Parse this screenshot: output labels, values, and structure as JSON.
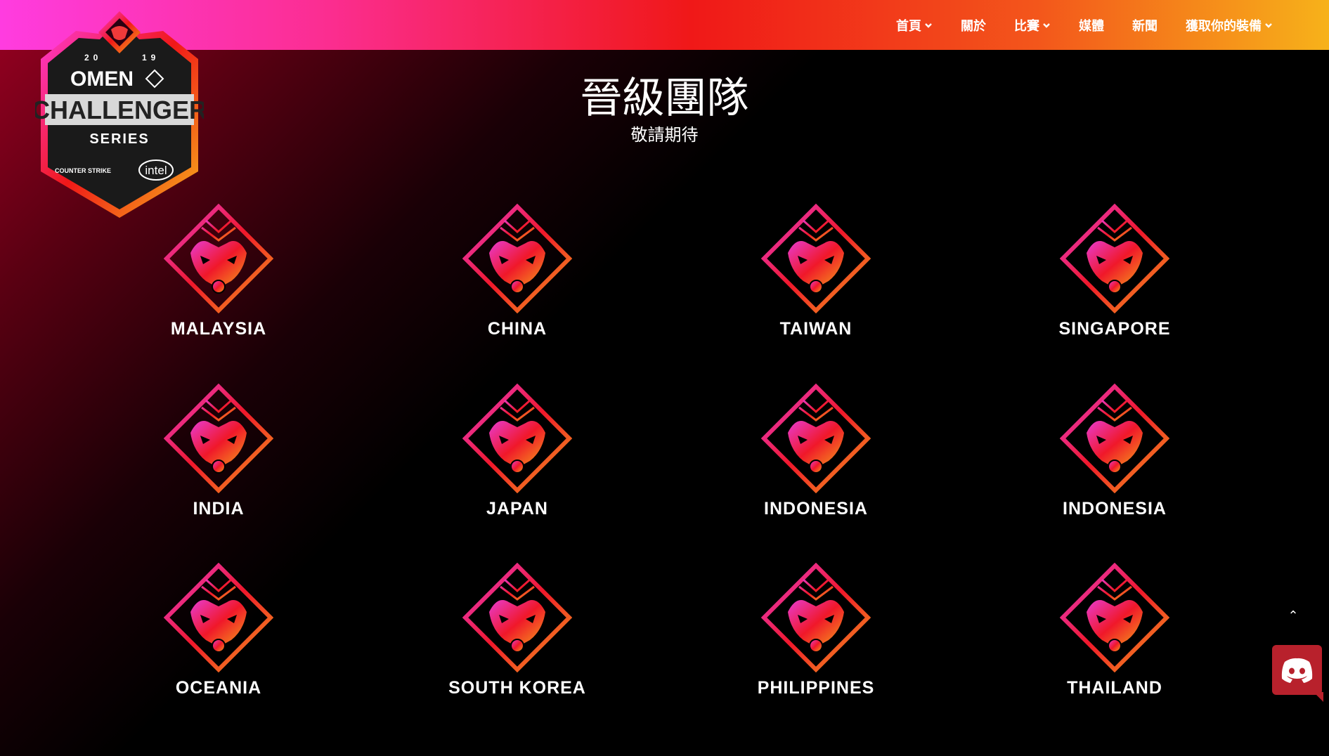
{
  "nav": {
    "items": [
      {
        "label": "首頁",
        "dropdown": true
      },
      {
        "label": "關於",
        "dropdown": false
      },
      {
        "label": "比賽",
        "dropdown": true
      },
      {
        "label": "媒體",
        "dropdown": false
      },
      {
        "label": "新聞",
        "dropdown": false
      },
      {
        "label": "獲取你的裝備",
        "dropdown": true
      }
    ]
  },
  "logo": {
    "year_left": "20",
    "year_right": "19",
    "brand": "OMEN",
    "title": "CHALLENGER",
    "subtitle": "SERIES",
    "sponsor1": "COUNTER STRIKE",
    "sponsor2": "intel"
  },
  "heading": {
    "title": "晉級團隊",
    "subtitle": "敬請期待"
  },
  "teams": [
    {
      "name": "MALAYSIA"
    },
    {
      "name": "CHINA"
    },
    {
      "name": "TAIWAN"
    },
    {
      "name": "SINGAPORE"
    },
    {
      "name": "INDIA"
    },
    {
      "name": "JAPAN"
    },
    {
      "name": "INDONESIA"
    },
    {
      "name": "INDONESIA"
    },
    {
      "name": "OCEANIA"
    },
    {
      "name": "SOUTH KOREA"
    },
    {
      "name": "PHILIPPINES"
    },
    {
      "name": "THAILAND"
    }
  ],
  "scroll_top": {
    "icon": "chevron-up-icon",
    "glyph": "⌃"
  },
  "discord": {
    "icon": "discord-icon"
  },
  "colors": {
    "header_gradient": [
      "#ff3ce0",
      "#f01818",
      "#f7b21a"
    ],
    "discord": "#b8212c",
    "team_logo_gradient": [
      "#e83bd0",
      "#f0182a",
      "#f5a21a"
    ]
  }
}
